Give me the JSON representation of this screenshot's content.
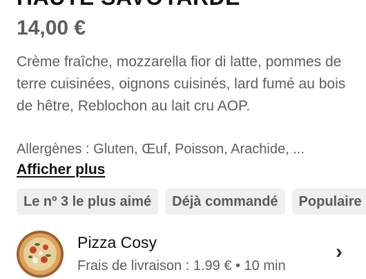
{
  "product": {
    "title": "HAUTE SAVOYARDE",
    "price": "14,00 €",
    "description": "Crème fraîche, mozzarella fior di latte, pommes de terre cuisinées, oignons cuisinés, lard fumé au bois de hêtre, Reblochon au lait cru AOP.",
    "allergens": "Allergènes : Gluten, Œuf, Poisson, Arachide, ...",
    "more_label": "Afficher plus"
  },
  "tags": [
    {
      "label": "Le nº 3 le plus aimé"
    },
    {
      "label": "Déjà commandé"
    },
    {
      "label": "Populaire"
    }
  ],
  "store": {
    "name": "Pizza Cosy",
    "meta": "Frais de livraison : 1.99 € • 10 min",
    "logo_icon": "pizza-logo",
    "chevron_icon": "chevron-right-icon"
  }
}
